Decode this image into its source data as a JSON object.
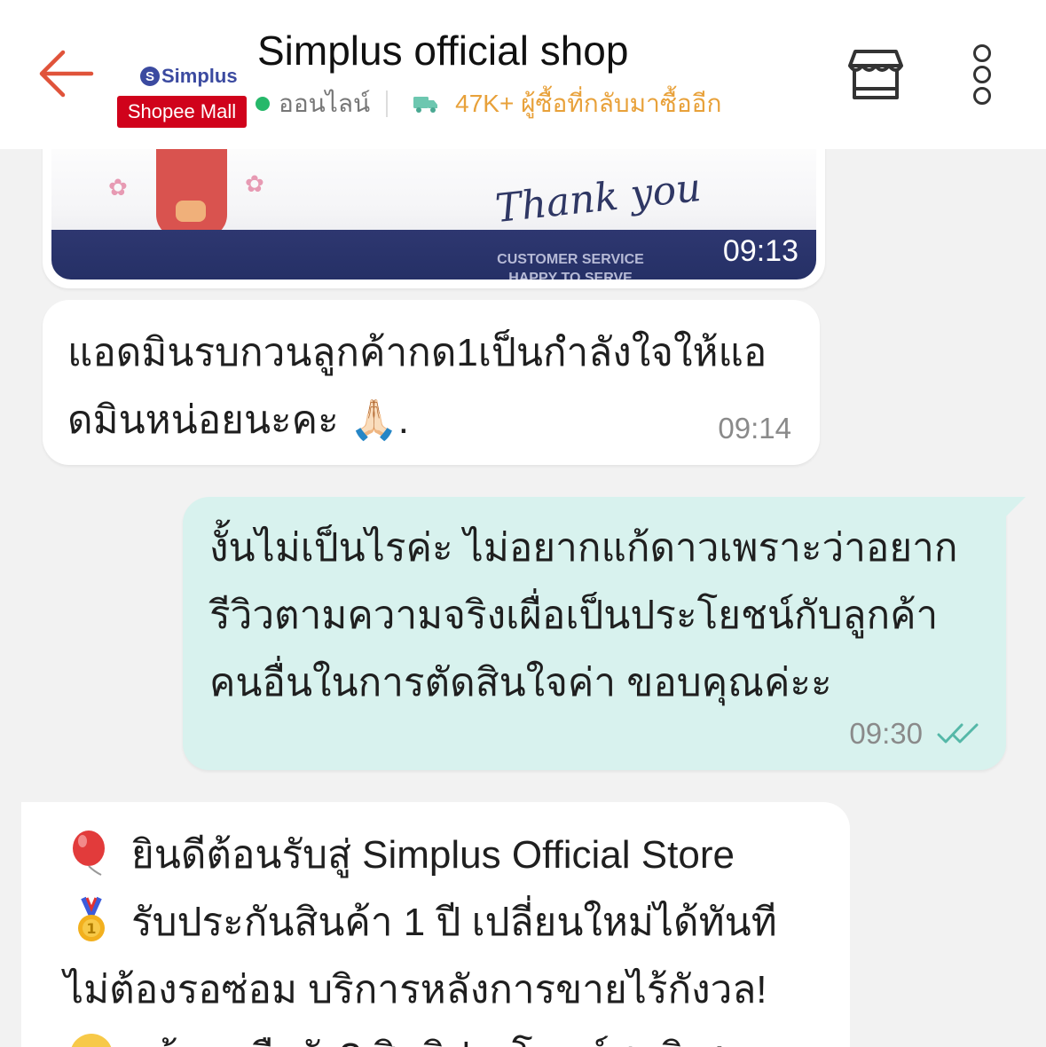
{
  "header": {
    "title": "Simplus official shop",
    "brand_logo": "Simplus",
    "brand_initial": "S",
    "mall_badge": "Shopee Mall",
    "status_online": "ออนไลน์",
    "repeat_buyers": "47K+ ผู้ซื้อที่กลับมาซื้ออีก",
    "icons": {
      "back": "back-arrow-icon",
      "store": "store-icon",
      "more": "more-vertical-icon",
      "truck": "truck-icon"
    },
    "colors": {
      "back_arrow": "#e0533a",
      "online": "#26b86a",
      "buyers": "#e8a13a",
      "mall": "#d0021b"
    }
  },
  "messages": {
    "image_message": {
      "script_text": "Thank you",
      "caption_line1": "CUSTOMER SERVICE",
      "caption_line2": "HAPPY TO SERVE",
      "time": "09:13"
    },
    "incoming_1": {
      "line1": "แอดมินรบกวนลูกค้ากด1เป็นกำลังใจให้แอ",
      "line2": "ดมินหน่อยนะคะ 🙏🏻.",
      "time": "09:14"
    },
    "outgoing_1": {
      "line1": "งั้นไม่เป็นไรค่ะ ไม่อยากแก้ดาวเพราะว่าอยาก",
      "line2": "รีวิวตามความจริงเผื่อเป็นประโยชน์กับลูกค้า",
      "line3": "คนอื่นในการตัดสินใจค่า ขอบคุณค่ะะ",
      "time": "09:30",
      "read_status": "double-check-icon"
    },
    "incoming_2": {
      "line1": "ยินดีต้อนรับสู่ Simplus Official Store",
      "line2": "รับประกันสินค้า 1 ปี เปลี่ยนใหม่ได้ทันที",
      "line3": "ไม่ต้องรอซ่อม บริการหลังการขายไร้กังวล!",
      "line4": "พร้อมหรือยัง? สิทธิประโยชน์สุดพิเศษ",
      "icons": [
        "balloon-icon",
        "medal-icon",
        "smile-icon"
      ]
    }
  }
}
